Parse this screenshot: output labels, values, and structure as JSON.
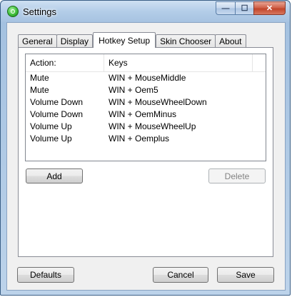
{
  "window": {
    "title": "Settings"
  },
  "caption_buttons": {
    "minimize": "—",
    "maximize": "☐",
    "close": "✕"
  },
  "tabs": [
    {
      "label": "General",
      "active": false
    },
    {
      "label": "Display",
      "active": false
    },
    {
      "label": "Hotkey Setup",
      "active": true
    },
    {
      "label": "Skin Chooser",
      "active": false
    },
    {
      "label": "About",
      "active": false
    }
  ],
  "hotkeys": {
    "columns": {
      "action": "Action:",
      "keys": "Keys"
    },
    "rows": [
      {
        "action": "Mute",
        "keys": "WIN + MouseMiddle"
      },
      {
        "action": "Mute",
        "keys": "WIN + Oem5"
      },
      {
        "action": "Volume Down",
        "keys": "WIN + MouseWheelDown"
      },
      {
        "action": "Volume Down",
        "keys": "WIN + OemMinus"
      },
      {
        "action": "Volume Up",
        "keys": "WIN + MouseWheelUp"
      },
      {
        "action": "Volume Up",
        "keys": "WIN + Oemplus"
      }
    ],
    "add_label": "Add",
    "delete_label": "Delete"
  },
  "footer": {
    "defaults_label": "Defaults",
    "cancel_label": "Cancel",
    "save_label": "Save"
  }
}
